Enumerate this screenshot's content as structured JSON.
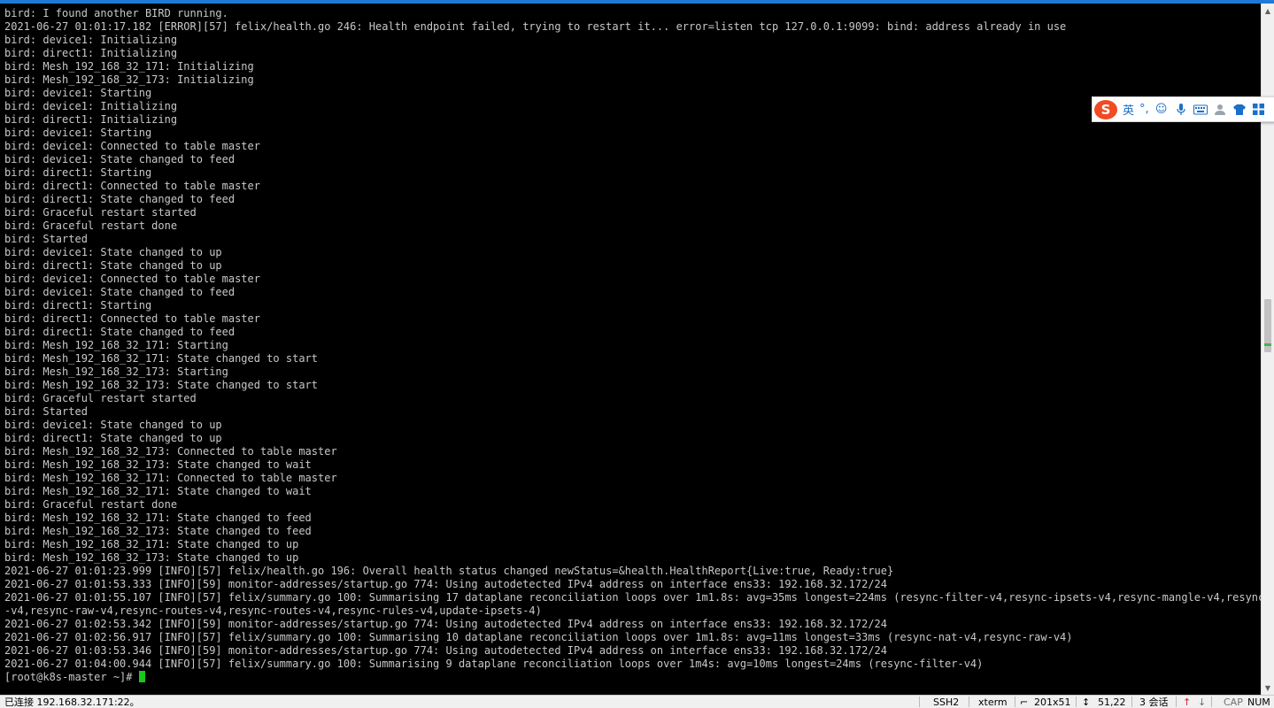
{
  "terminal": {
    "lines": [
      "bird: I found another BIRD running.",
      "2021-06-27 01:01:17.182 [ERROR][57] felix/health.go 246: Health endpoint failed, trying to restart it... error=listen tcp 127.0.0.1:9099: bind: address already in use",
      "bird: device1: Initializing",
      "bird: direct1: Initializing",
      "bird: Mesh_192_168_32_171: Initializing",
      "bird: Mesh_192_168_32_173: Initializing",
      "bird: device1: Starting",
      "bird: device1: Initializing",
      "bird: direct1: Initializing",
      "bird: device1: Starting",
      "bird: device1: Connected to table master",
      "bird: device1: State changed to feed",
      "bird: direct1: Starting",
      "bird: direct1: Connected to table master",
      "bird: direct1: State changed to feed",
      "bird: Graceful restart started",
      "bird: Graceful restart done",
      "bird: Started",
      "bird: device1: State changed to up",
      "bird: direct1: State changed to up",
      "bird: device1: Connected to table master",
      "bird: device1: State changed to feed",
      "bird: direct1: Starting",
      "bird: direct1: Connected to table master",
      "bird: direct1: State changed to feed",
      "bird: Mesh_192_168_32_171: Starting",
      "bird: Mesh_192_168_32_171: State changed to start",
      "bird: Mesh_192_168_32_173: Starting",
      "bird: Mesh_192_168_32_173: State changed to start",
      "bird: Graceful restart started",
      "bird: Started",
      "bird: device1: State changed to up",
      "bird: direct1: State changed to up",
      "bird: Mesh_192_168_32_173: Connected to table master",
      "bird: Mesh_192_168_32_173: State changed to wait",
      "bird: Mesh_192_168_32_171: Connected to table master",
      "bird: Mesh_192_168_32_171: State changed to wait",
      "bird: Graceful restart done",
      "bird: Mesh_192_168_32_171: State changed to feed",
      "bird: Mesh_192_168_32_173: State changed to feed",
      "bird: Mesh_192_168_32_171: State changed to up",
      "bird: Mesh_192_168_32_173: State changed to up",
      "2021-06-27 01:01:23.999 [INFO][57] felix/health.go 196: Overall health status changed newStatus=&health.HealthReport{Live:true, Ready:true}",
      "2021-06-27 01:01:53.333 [INFO][59] monitor-addresses/startup.go 774: Using autodetected IPv4 address on interface ens33: 192.168.32.172/24",
      "2021-06-27 01:01:55.107 [INFO][57] felix/summary.go 100: Summarising 17 dataplane reconciliation loops over 1m1.8s: avg=35ms longest=224ms (resync-filter-v4,resync-ipsets-v4,resync-mangle-v4,resync-nat",
      "-v4,resync-raw-v4,resync-routes-v4,resync-routes-v4,resync-rules-v4,update-ipsets-4)",
      "2021-06-27 01:02:53.342 [INFO][59] monitor-addresses/startup.go 774: Using autodetected IPv4 address on interface ens33: 192.168.32.172/24",
      "2021-06-27 01:02:56.917 [INFO][57] felix/summary.go 100: Summarising 10 dataplane reconciliation loops over 1m1.8s: avg=11ms longest=33ms (resync-nat-v4,resync-raw-v4)",
      "2021-06-27 01:03:53.346 [INFO][59] monitor-addresses/startup.go 774: Using autodetected IPv4 address on interface ens33: 192.168.32.172/24",
      "2021-06-27 01:04:00.944 [INFO][57] felix/summary.go 100: Summarising 9 dataplane reconciliation loops over 1m4s: avg=10ms longest=24ms (resync-filter-v4)"
    ],
    "prompt": "[root@k8s-master ~]# ",
    "cursor_color": "#19c919",
    "text_color": "#c8c8c8",
    "background": "#000000"
  },
  "ime_toolbar": {
    "logo": "S",
    "lang_label": "英",
    "punct_label": "°,",
    "icons": [
      "smiley-icon",
      "microphone-icon",
      "keyboard-icon",
      "user-icon",
      "skin-icon",
      "grid-icon"
    ]
  },
  "status_bar": {
    "connection": "已连接 192.168.32.171:22。",
    "protocol": "SSH2",
    "terminal_type": "xterm",
    "size": "201x51",
    "cursor_pos": "51,22",
    "sessions": "3 会话",
    "cap": "CAP",
    "num": "NUM"
  }
}
